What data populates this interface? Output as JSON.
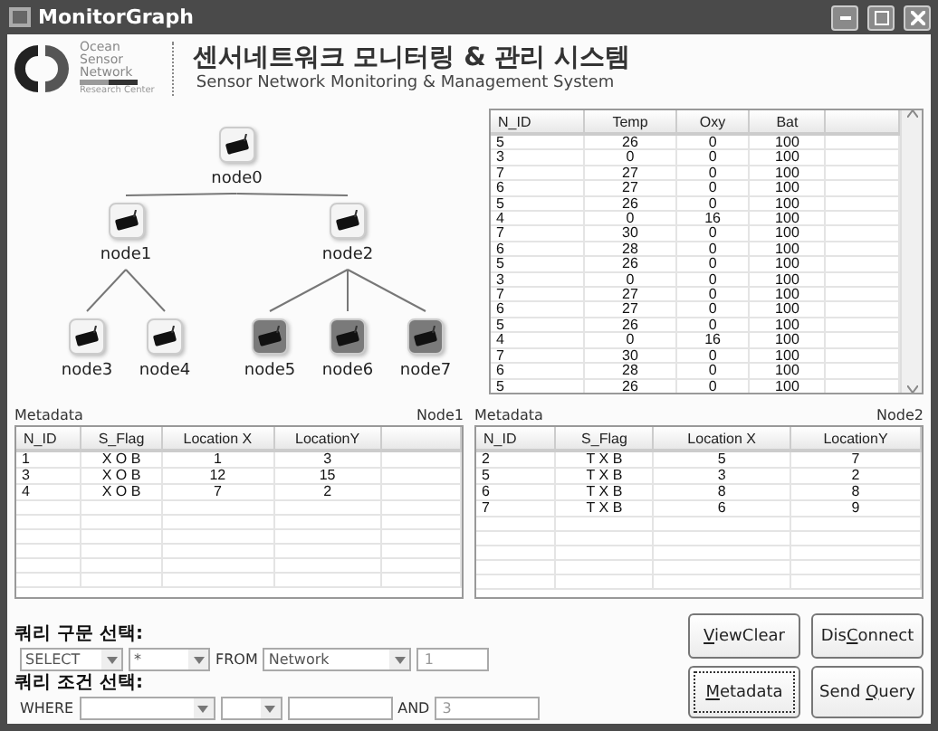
{
  "window": {
    "title": "MonitorGraph"
  },
  "header": {
    "logo_lines": [
      "Ocean",
      "Sensor",
      "Network"
    ],
    "logo_caption": "Research Center",
    "title": "센서네트워크 모니터링 & 관리 시스템",
    "subtitle": "Sensor Network Monitoring & Management System"
  },
  "tree": {
    "label": "node0",
    "active": true,
    "children": [
      {
        "label": "node1",
        "active": true,
        "children": [
          {
            "label": "node3",
            "active": true
          },
          {
            "label": "node4",
            "active": true
          }
        ]
      },
      {
        "label": "node2",
        "active": true,
        "children": [
          {
            "label": "node5",
            "active": false
          },
          {
            "label": "node6",
            "active": false
          },
          {
            "label": "node7",
            "active": false
          }
        ]
      }
    ]
  },
  "readings": {
    "columns": [
      "N_ID",
      "Temp",
      "Oxy",
      "Bat"
    ],
    "rows": [
      [
        "5",
        "26",
        "0",
        "100"
      ],
      [
        "3",
        "0",
        "0",
        "100"
      ],
      [
        "7",
        "27",
        "0",
        "100"
      ],
      [
        "6",
        "27",
        "0",
        "100"
      ],
      [
        "5",
        "26",
        "0",
        "100"
      ],
      [
        "4",
        "0",
        "16",
        "100"
      ],
      [
        "7",
        "30",
        "0",
        "100"
      ],
      [
        "6",
        "28",
        "0",
        "100"
      ],
      [
        "5",
        "26",
        "0",
        "100"
      ],
      [
        "3",
        "0",
        "0",
        "100"
      ],
      [
        "7",
        "27",
        "0",
        "100"
      ],
      [
        "6",
        "27",
        "0",
        "100"
      ],
      [
        "5",
        "26",
        "0",
        "100"
      ],
      [
        "4",
        "0",
        "16",
        "100"
      ],
      [
        "7",
        "30",
        "0",
        "100"
      ],
      [
        "6",
        "28",
        "0",
        "100"
      ],
      [
        "5",
        "26",
        "0",
        "100"
      ]
    ]
  },
  "metadata_panels": [
    {
      "title": "Metadata",
      "node": "Node1",
      "columns": [
        "N_ID",
        "S_Flag",
        "Location X",
        "LocationY"
      ],
      "rows": [
        [
          "1",
          "X O B",
          "1",
          "3"
        ],
        [
          "3",
          "X O B",
          "12",
          "15"
        ],
        [
          "4",
          "X O B",
          "7",
          "2"
        ]
      ]
    },
    {
      "title": "Metadata",
      "node": "Node2",
      "columns": [
        "N_ID",
        "S_Flag",
        "Location X",
        "LocationY"
      ],
      "rows": [
        [
          "2",
          "T X B",
          "5",
          "7"
        ],
        [
          "5",
          "T X B",
          "3",
          "2"
        ],
        [
          "6",
          "T X B",
          "8",
          "8"
        ],
        [
          "7",
          "T X B",
          "6",
          "9"
        ]
      ]
    }
  ],
  "query": {
    "select_label": "쿼리 구문 선택:",
    "select_keyword": "SELECT",
    "column": "*",
    "from_label": "FROM",
    "table": "Network",
    "select_value": "1",
    "condition_label": "쿼리 조건 선택:",
    "where_label": "WHERE",
    "and_label": "AND",
    "and_value": "3"
  },
  "buttons": [
    {
      "access_key": "V",
      "after_key": "iewClear",
      "focused": false
    },
    {
      "before_key": "Dis",
      "access_key": "C",
      "after_key": "onnect",
      "focused": false
    },
    {
      "access_key": "M",
      "after_key": "etadata",
      "focused": true
    },
    {
      "before_key": "Send ",
      "access_key": "Q",
      "after_key": "uery",
      "focused": false
    }
  ]
}
